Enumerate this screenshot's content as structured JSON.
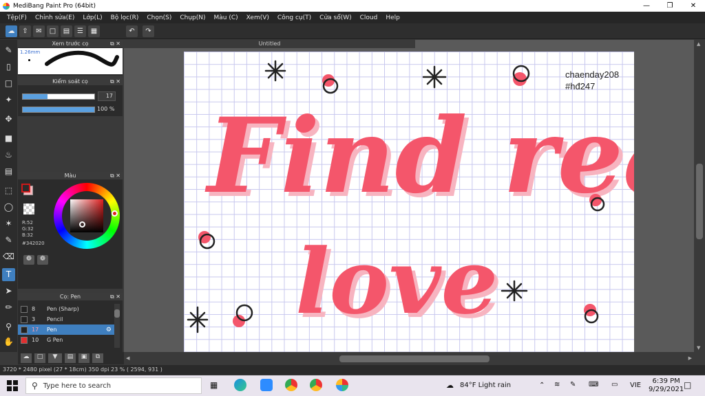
{
  "window": {
    "title": "MediBang Paint Pro (64bit)"
  },
  "menu": [
    "Tệp(F)",
    "Chỉnh sửa(E)",
    "Lớp(L)",
    "Bộ lọc(R)",
    "Chọn(S)",
    "Chụp(N)",
    "Màu (C)",
    "Xem(V)",
    "Công cụ(T)",
    "Cửa sổ(W)",
    "Cloud",
    "Help"
  ],
  "document": {
    "tab_title": "Untitled"
  },
  "panels": {
    "brush_preview": {
      "title": "Xem trước cọ",
      "size_label": "1.26mm"
    },
    "brush_control": {
      "title": "Kiểm soát cọ",
      "size_value": "17",
      "size_fraction": 0.35,
      "opacity_value": "100 %",
      "opacity_fraction": 1.0
    },
    "color": {
      "title": "Màu",
      "r": "R:52",
      "g": "G:32",
      "b": "B:32",
      "hex": "#342020",
      "primary": "#cc1a1a",
      "secondary": "#f7b8bd"
    },
    "brush_list": {
      "title": "Cọ: Pen",
      "items": [
        {
          "num": "8",
          "name": "Pen (Sharp)",
          "swatch": "#222222"
        },
        {
          "num": "3",
          "name": "Pencil",
          "swatch": "#222222"
        },
        {
          "num": "17",
          "name": "Pen",
          "swatch": "#222222"
        },
        {
          "num": "10",
          "name": "G Pen",
          "swatch": "#e03030"
        }
      ]
    }
  },
  "artwork": {
    "line1": "Find real",
    "line2": "love",
    "signature1": "chaenday208",
    "signature2": "#hđ247",
    "ink_color": "#f4566b",
    "shadow_color": "#f7b4c0"
  },
  "status": {
    "text": "3720 * 2480 pixel   (27 * 18cm)   350 dpi   23 %   ( 2594, 931 )"
  },
  "taskbar": {
    "search_placeholder": "Type here to search",
    "weather": "84°F  Light rain",
    "lang": "VIE",
    "time": "6:39 PM",
    "date": "9/29/2021"
  }
}
